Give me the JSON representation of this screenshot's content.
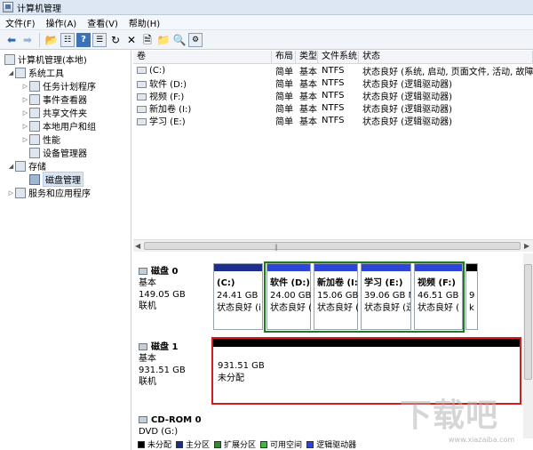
{
  "window": {
    "title": "计算机管理"
  },
  "menu": [
    "文件(F)",
    "操作(A)",
    "查看(V)",
    "帮助(H)"
  ],
  "toolbar": {
    "icons": [
      "back-arrow-icon",
      "forward-arrow-icon",
      "up-folder-icon",
      "show-hide-tree-icon",
      "help-icon",
      "export-list-icon",
      "connect-icon",
      "delete-icon",
      "properties-icon",
      "open-folder-icon",
      "search-icon",
      "settings-icon"
    ]
  },
  "tree": {
    "root": "计算机管理(本地)",
    "system_tools": "系统工具",
    "task_scheduler": "任务计划程序",
    "event_viewer": "事件查看器",
    "shared_folders": "共享文件夹",
    "local_users": "本地用户和组",
    "performance": "性能",
    "device_manager": "设备管理器",
    "storage": "存储",
    "disk_management": "磁盘管理",
    "services": "服务和应用程序"
  },
  "volume_table": {
    "columns": [
      "卷",
      "布局",
      "类型",
      "文件系统",
      "状态"
    ],
    "rows": [
      {
        "volume": "(C:)",
        "layout": "简单",
        "type": "基本",
        "fs": "NTFS",
        "status": "状态良好 (系统, 启动, 页面文件, 活动, 故障转储"
      },
      {
        "volume": "软件 (D:)",
        "layout": "简单",
        "type": "基本",
        "fs": "NTFS",
        "status": "状态良好 (逻辑驱动器)"
      },
      {
        "volume": "视频 (F:)",
        "layout": "简单",
        "type": "基本",
        "fs": "NTFS",
        "status": "状态良好 (逻辑驱动器)"
      },
      {
        "volume": "新加卷 (I:)",
        "layout": "简单",
        "type": "基本",
        "fs": "NTFS",
        "status": "状态良好 (逻辑驱动器)"
      },
      {
        "volume": "学习 (E:)",
        "layout": "简单",
        "type": "基本",
        "fs": "NTFS",
        "status": "状态良好 (逻辑驱动器)"
      }
    ]
  },
  "disk0": {
    "name": "磁盘 0",
    "type": "基本",
    "size": "149.05 GB",
    "state": "联机",
    "partitions": [
      {
        "label": "(C:)",
        "size": "24.41 GB I",
        "status": "状态良好 (i"
      },
      {
        "label": "软件 (D:)",
        "size": "24.00 GB",
        "status": "状态良好 ("
      },
      {
        "label": "新加卷 (I:",
        "size": "15.06 GB",
        "status": "状态良好 ("
      },
      {
        "label": "学习 (E:)",
        "size": "39.06 GB N",
        "status": "状态良好 (逻"
      },
      {
        "label": "视频 (F:)",
        "size": "46.51 GB I",
        "status": "状态良好 ("
      },
      {
        "label": "",
        "size": "9",
        "status": "k"
      }
    ]
  },
  "disk1": {
    "name": "磁盘 1",
    "type": "基本",
    "size": "931.51 GB",
    "state": "联机",
    "partition": {
      "size": "931.51 GB",
      "status": "未分配"
    }
  },
  "cdrom": {
    "name": "CD-ROM 0",
    "drive": "DVD (G:)"
  },
  "legend": [
    {
      "label": "未分配",
      "color": "#000000"
    },
    {
      "label": "主分区",
      "color": "#1c2f8f"
    },
    {
      "label": "扩展分区",
      "color": "#2e8b2e"
    },
    {
      "label": "可用空间",
      "color": "#3cbc3c"
    },
    {
      "label": "逻辑驱动器",
      "color": "#2b46d9"
    }
  ],
  "watermark": {
    "text": "下载吧",
    "url": "www.xiazaiba.com"
  },
  "colors": {
    "primary_partition": "#1c2f8f",
    "logical_drive": "#2b46d9",
    "unallocated": "#000000",
    "highlight_green": "#1f7a1f",
    "highlight_red": "#d51b1b"
  }
}
